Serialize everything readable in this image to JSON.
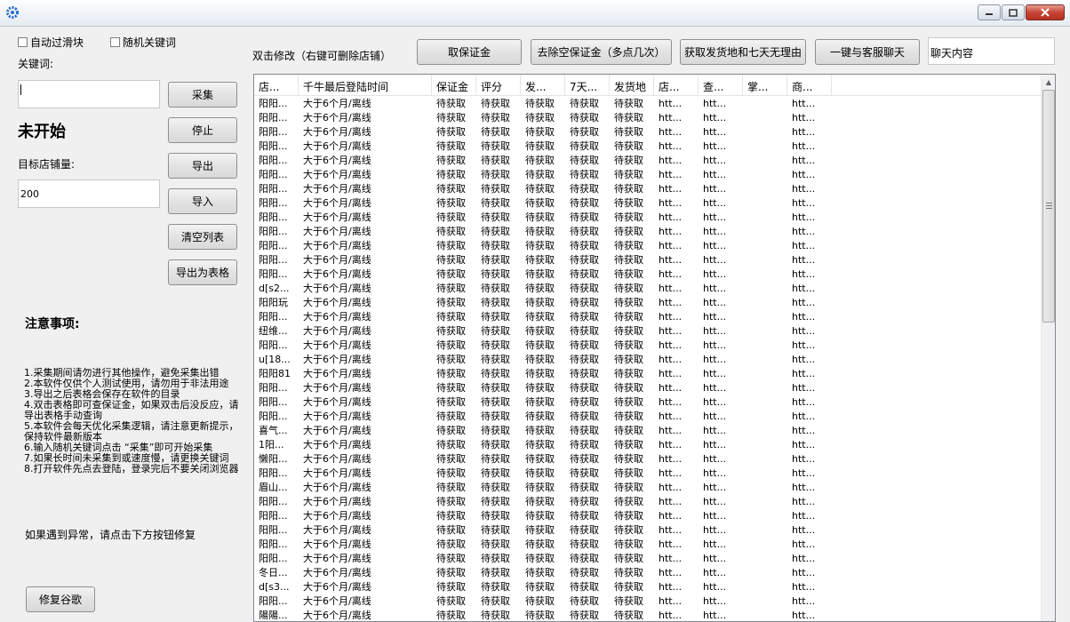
{
  "window": {
    "title": ""
  },
  "options": {
    "auto_slider": "自动过滑块",
    "random_keyword": "随机关键词"
  },
  "keyword": {
    "label": "关键词:",
    "value": ""
  },
  "buttons": {
    "collect": "采集",
    "stop": "停止",
    "export": "导出",
    "import": "导入",
    "clear": "清空列表",
    "export_sheet": "导出为表格",
    "get_deposit": "取保证金",
    "remove_empty": "去除空保证金（多点几次）",
    "get_origin": "获取发货地和七天无理由",
    "chat": "一键与客服聊天",
    "fix": "修复谷歌"
  },
  "status": "未开始",
  "target": {
    "label": "目标店铺量:",
    "value": "200"
  },
  "hint": "双击修改（右键可删除店铺）",
  "chat_input": {
    "value": "聊天内容"
  },
  "notes": {
    "title": "注意事项:",
    "items": [
      "1.采集期间请勿进行其他操作，避免采集出错",
      "2.本软件仅供个人测试使用，请勿用于非法用途",
      "3.导出之后表格会保存在软件的目录",
      "4.双击表格即可查保证金，如果双击后没反应，请导出表格手动查询",
      "5.本软件会每天优化采集逻辑，请注意更新提示，保持软件最新版本",
      "6.输入随机关键词点击 “采集”即可开始采集",
      "7.如果长时间未采集到或速度慢，请更换关键词",
      "8.打开软件先点去登陆，登录完后不要关闭浏览器"
    ],
    "error": "如果遇到异常，请点击下方按钮修复"
  },
  "table": {
    "columns": [
      "店...",
      "千牛最后登陆时间",
      "保证金",
      "评分",
      "发...",
      "7天...",
      "发货地",
      "店...",
      "查...",
      "掌...",
      "商..."
    ],
    "rows": [
      [
        "阳阳...",
        "大于6个月/离线",
        "待获取",
        "待获取",
        "待获取",
        "待获取",
        "待获取",
        "htt...",
        "htt...",
        "",
        "htt..."
      ],
      [
        "阳阳...",
        "大于6个月/离线",
        "待获取",
        "待获取",
        "待获取",
        "待获取",
        "待获取",
        "htt...",
        "htt...",
        "",
        "htt..."
      ],
      [
        "阳阳...",
        "大于6个月/离线",
        "待获取",
        "待获取",
        "待获取",
        "待获取",
        "待获取",
        "htt...",
        "htt...",
        "",
        "htt..."
      ],
      [
        "阳阳...",
        "大于6个月/离线",
        "待获取",
        "待获取",
        "待获取",
        "待获取",
        "待获取",
        "htt...",
        "htt...",
        "",
        "htt..."
      ],
      [
        "阳阳...",
        "大于6个月/离线",
        "待获取",
        "待获取",
        "待获取",
        "待获取",
        "待获取",
        "htt...",
        "htt...",
        "",
        "htt..."
      ],
      [
        "阳阳...",
        "大于6个月/离线",
        "待获取",
        "待获取",
        "待获取",
        "待获取",
        "待获取",
        "htt...",
        "htt...",
        "",
        "htt..."
      ],
      [
        "阳阳...",
        "大于6个月/离线",
        "待获取",
        "待获取",
        "待获取",
        "待获取",
        "待获取",
        "htt...",
        "htt...",
        "",
        "htt..."
      ],
      [
        "阳阳...",
        "大于6个月/离线",
        "待获取",
        "待获取",
        "待获取",
        "待获取",
        "待获取",
        "htt...",
        "htt...",
        "",
        "htt..."
      ],
      [
        "阳阳...",
        "大于6个月/离线",
        "待获取",
        "待获取",
        "待获取",
        "待获取",
        "待获取",
        "htt...",
        "htt...",
        "",
        "htt..."
      ],
      [
        "阳阳...",
        "大于6个月/离线",
        "待获取",
        "待获取",
        "待获取",
        "待获取",
        "待获取",
        "htt...",
        "htt...",
        "",
        "htt..."
      ],
      [
        "阳阳...",
        "大于6个月/离线",
        "待获取",
        "待获取",
        "待获取",
        "待获取",
        "待获取",
        "htt...",
        "htt...",
        "",
        "htt..."
      ],
      [
        "阳阳...",
        "大于6个月/离线",
        "待获取",
        "待获取",
        "待获取",
        "待获取",
        "待获取",
        "htt...",
        "htt...",
        "",
        "htt..."
      ],
      [
        "阳阳...",
        "大于6个月/离线",
        "待获取",
        "待获取",
        "待获取",
        "待获取",
        "待获取",
        "htt...",
        "htt...",
        "",
        "htt..."
      ],
      [
        "d[s2...",
        "大于6个月/离线",
        "待获取",
        "待获取",
        "待获取",
        "待获取",
        "待获取",
        "htt...",
        "htt...",
        "",
        "htt..."
      ],
      [
        "阳阳玩",
        "大于6个月/离线",
        "待获取",
        "待获取",
        "待获取",
        "待获取",
        "待获取",
        "htt...",
        "htt...",
        "",
        "htt..."
      ],
      [
        "阳阳...",
        "大于6个月/离线",
        "待获取",
        "待获取",
        "待获取",
        "待获取",
        "待获取",
        "htt...",
        "htt...",
        "",
        "htt..."
      ],
      [
        "纽维...",
        "大于6个月/离线",
        "待获取",
        "待获取",
        "待获取",
        "待获取",
        "待获取",
        "htt...",
        "htt...",
        "",
        "htt..."
      ],
      [
        "阳阳...",
        "大于6个月/离线",
        "待获取",
        "待获取",
        "待获取",
        "待获取",
        "待获取",
        "htt...",
        "htt...",
        "",
        "htt..."
      ],
      [
        "u[18...",
        "大于6个月/离线",
        "待获取",
        "待获取",
        "待获取",
        "待获取",
        "待获取",
        "htt...",
        "htt...",
        "",
        "htt..."
      ],
      [
        "阳阳81",
        "大于6个月/离线",
        "待获取",
        "待获取",
        "待获取",
        "待获取",
        "待获取",
        "htt...",
        "htt...",
        "",
        "htt..."
      ],
      [
        "阳阳...",
        "大于6个月/离线",
        "待获取",
        "待获取",
        "待获取",
        "待获取",
        "待获取",
        "htt...",
        "htt...",
        "",
        "htt..."
      ],
      [
        "阳阳...",
        "大于6个月/离线",
        "待获取",
        "待获取",
        "待获取",
        "待获取",
        "待获取",
        "htt...",
        "htt...",
        "",
        "htt..."
      ],
      [
        "阳阳...",
        "大于6个月/离线",
        "待获取",
        "待获取",
        "待获取",
        "待获取",
        "待获取",
        "htt...",
        "htt...",
        "",
        "htt..."
      ],
      [
        "喜气...",
        "大于6个月/离线",
        "待获取",
        "待获取",
        "待获取",
        "待获取",
        "待获取",
        "htt...",
        "htt...",
        "",
        "htt..."
      ],
      [
        "1阳...",
        "大于6个月/离线",
        "待获取",
        "待获取",
        "待获取",
        "待获取",
        "待获取",
        "htt...",
        "htt...",
        "",
        "htt..."
      ],
      [
        "懒阳...",
        "大于6个月/离线",
        "待获取",
        "待获取",
        "待获取",
        "待获取",
        "待获取",
        "htt...",
        "htt...",
        "",
        "htt..."
      ],
      [
        "阳阳...",
        "大于6个月/离线",
        "待获取",
        "待获取",
        "待获取",
        "待获取",
        "待获取",
        "htt...",
        "htt...",
        "",
        "htt..."
      ],
      [
        "眉山...",
        "大于6个月/离线",
        "待获取",
        "待获取",
        "待获取",
        "待获取",
        "待获取",
        "htt...",
        "htt...",
        "",
        "htt..."
      ],
      [
        "阳阳...",
        "大于6个月/离线",
        "待获取",
        "待获取",
        "待获取",
        "待获取",
        "待获取",
        "htt...",
        "htt...",
        "",
        "htt..."
      ],
      [
        "阳阳...",
        "大于6个月/离线",
        "待获取",
        "待获取",
        "待获取",
        "待获取",
        "待获取",
        "htt...",
        "htt...",
        "",
        "htt..."
      ],
      [
        "阳阳...",
        "大于6个月/离线",
        "待获取",
        "待获取",
        "待获取",
        "待获取",
        "待获取",
        "htt...",
        "htt...",
        "",
        "htt..."
      ],
      [
        "阳阳...",
        "大于6个月/离线",
        "待获取",
        "待获取",
        "待获取",
        "待获取",
        "待获取",
        "htt...",
        "htt...",
        "",
        "htt..."
      ],
      [
        "阳阳...",
        "大于6个月/离线",
        "待获取",
        "待获取",
        "待获取",
        "待获取",
        "待获取",
        "htt...",
        "htt...",
        "",
        "htt..."
      ],
      [
        "冬日...",
        "大于6个月/离线",
        "待获取",
        "待获取",
        "待获取",
        "待获取",
        "待获取",
        "htt...",
        "htt...",
        "",
        "htt..."
      ],
      [
        "d[s3...",
        "大于6个月/离线",
        "待获取",
        "待获取",
        "待获取",
        "待获取",
        "待获取",
        "htt...",
        "htt...",
        "",
        "htt..."
      ],
      [
        "阳阳...",
        "大于6个月/离线",
        "待获取",
        "待获取",
        "待获取",
        "待获取",
        "待获取",
        "htt...",
        "htt...",
        "",
        "htt..."
      ],
      [
        "陽陽...",
        "大于6个月/离线",
        "待获取",
        "待获取",
        "待获取",
        "待获取",
        "待获取",
        "htt...",
        "htt...",
        "",
        "htt..."
      ]
    ]
  }
}
